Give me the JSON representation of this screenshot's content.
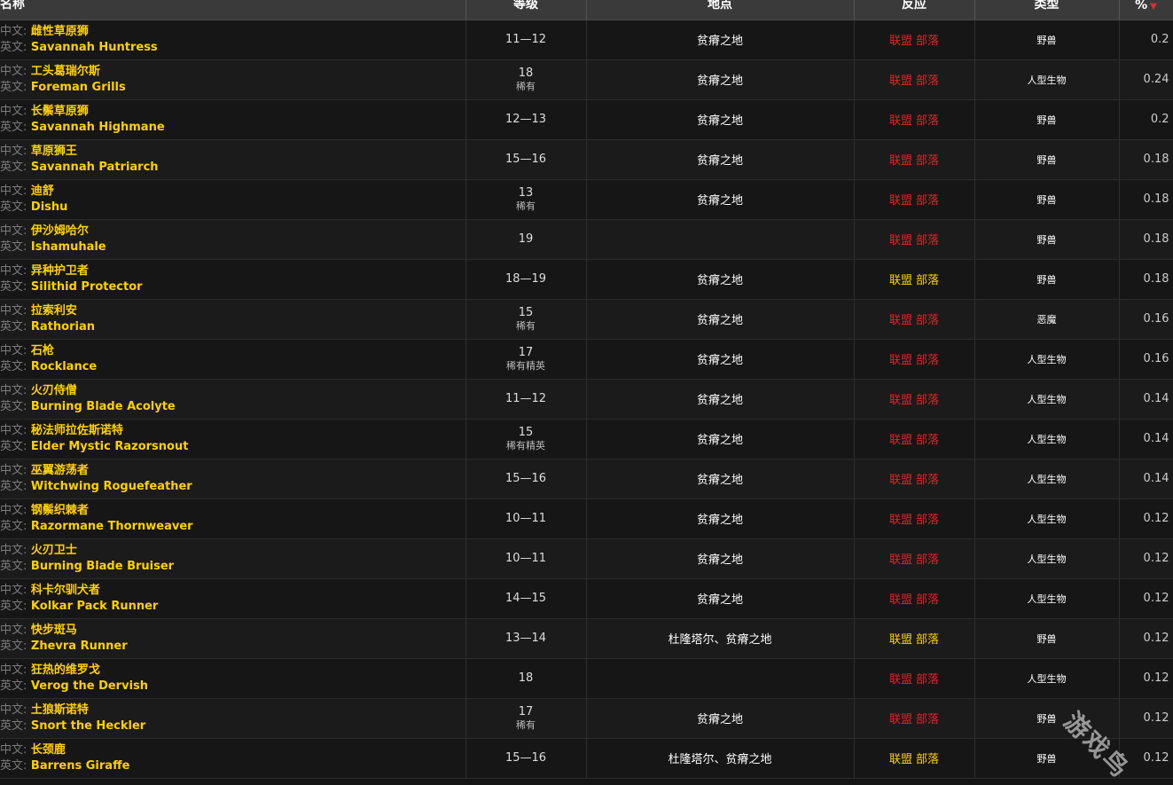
{
  "headers": {
    "name": "名称",
    "level": "等级",
    "location": "地点",
    "reaction": "反应",
    "type": "类型",
    "percent": "%"
  },
  "prefix_cn": "中文:",
  "prefix_en": "英文:",
  "faction_labels": {
    "alliance": "联盟",
    "horde": "部落"
  },
  "colors": {
    "hostile": "#e02525",
    "friendly": "#ffd100",
    "name": "#ffd100"
  },
  "rows": [
    {
      "cn": "雌性草原狮",
      "en": "Savannah Huntress",
      "level": "11—12",
      "class": "",
      "location": "贫瘠之地",
      "alliance": "red",
      "horde": "red",
      "type": "野兽",
      "pct": "0.2"
    },
    {
      "cn": "工头葛瑞尔斯",
      "en": "Foreman Grills",
      "level": "18",
      "class": "稀有",
      "location": "贫瘠之地",
      "alliance": "red",
      "horde": "red",
      "type": "人型生物",
      "pct": "0.24"
    },
    {
      "cn": "长鬃草原狮",
      "en": "Savannah Highmane",
      "level": "12—13",
      "class": "",
      "location": "贫瘠之地",
      "alliance": "red",
      "horde": "red",
      "type": "野兽",
      "pct": "0.2"
    },
    {
      "cn": "草原狮王",
      "en": "Savannah Patriarch",
      "level": "15—16",
      "class": "",
      "location": "贫瘠之地",
      "alliance": "red",
      "horde": "red",
      "type": "野兽",
      "pct": "0.18"
    },
    {
      "cn": "迪舒",
      "en": "Dishu",
      "level": "13",
      "class": "稀有",
      "location": "贫瘠之地",
      "alliance": "red",
      "horde": "red",
      "type": "野兽",
      "pct": "0.18"
    },
    {
      "cn": "伊沙姆哈尔",
      "en": "Ishamuhale",
      "level": "19",
      "class": "",
      "location": "",
      "alliance": "red",
      "horde": "red",
      "type": "野兽",
      "pct": "0.18"
    },
    {
      "cn": "异种护卫者",
      "en": "Silithid Protector",
      "level": "18—19",
      "class": "",
      "location": "贫瘠之地",
      "alliance": "yel",
      "horde": "yel",
      "type": "野兽",
      "pct": "0.18"
    },
    {
      "cn": "拉索利安",
      "en": "Rathorian",
      "level": "15",
      "class": "稀有",
      "location": "贫瘠之地",
      "alliance": "red",
      "horde": "red",
      "type": "恶魔",
      "pct": "0.16"
    },
    {
      "cn": "石枪",
      "en": "Rocklance",
      "level": "17",
      "class": "稀有精英",
      "location": "贫瘠之地",
      "alliance": "red",
      "horde": "red",
      "type": "人型生物",
      "pct": "0.16"
    },
    {
      "cn": "火刃侍僧",
      "en": "Burning Blade Acolyte",
      "level": "11—12",
      "class": "",
      "location": "贫瘠之地",
      "alliance": "red",
      "horde": "red",
      "type": "人型生物",
      "pct": "0.14"
    },
    {
      "cn": "秘法师拉佐斯诺特",
      "en": "Elder Mystic Razorsnout",
      "level": "15",
      "class": "稀有精英",
      "location": "贫瘠之地",
      "alliance": "red",
      "horde": "red",
      "type": "人型生物",
      "pct": "0.14"
    },
    {
      "cn": "巫翼游荡者",
      "en": "Witchwing Roguefeather",
      "level": "15—16",
      "class": "",
      "location": "贫瘠之地",
      "alliance": "red",
      "horde": "red",
      "type": "人型生物",
      "pct": "0.14"
    },
    {
      "cn": "钢鬃织棘者",
      "en": "Razormane Thornweaver",
      "level": "10—11",
      "class": "",
      "location": "贫瘠之地",
      "alliance": "red",
      "horde": "red",
      "type": "人型生物",
      "pct": "0.12"
    },
    {
      "cn": "火刃卫士",
      "en": "Burning Blade Bruiser",
      "level": "10—11",
      "class": "",
      "location": "贫瘠之地",
      "alliance": "red",
      "horde": "red",
      "type": "人型生物",
      "pct": "0.12"
    },
    {
      "cn": "科卡尔驯犬者",
      "en": "Kolkar Pack Runner",
      "level": "14—15",
      "class": "",
      "location": "贫瘠之地",
      "alliance": "red",
      "horde": "red",
      "type": "人型生物",
      "pct": "0.12"
    },
    {
      "cn": "快步斑马",
      "en": "Zhevra Runner",
      "level": "13—14",
      "class": "",
      "location": "杜隆塔尔、贫瘠之地",
      "alliance": "yel",
      "horde": "yel",
      "type": "野兽",
      "pct": "0.12"
    },
    {
      "cn": "狂热的维罗戈",
      "en": "Verog the Dervish",
      "level": "18",
      "class": "",
      "location": "",
      "alliance": "red",
      "horde": "red",
      "type": "人型生物",
      "pct": "0.12"
    },
    {
      "cn": "土狼斯诺特",
      "en": "Snort the Heckler",
      "level": "17",
      "class": "稀有",
      "location": "贫瘠之地",
      "alliance": "red",
      "horde": "red",
      "type": "野兽",
      "pct": "0.12"
    },
    {
      "cn": "长颈鹿",
      "en": "Barrens Giraffe",
      "level": "15—16",
      "class": "",
      "location": "杜隆塔尔、贫瘠之地",
      "alliance": "yel",
      "horde": "yel",
      "type": "野兽",
      "pct": "0.12"
    }
  ],
  "watermark": "游戏鸟"
}
